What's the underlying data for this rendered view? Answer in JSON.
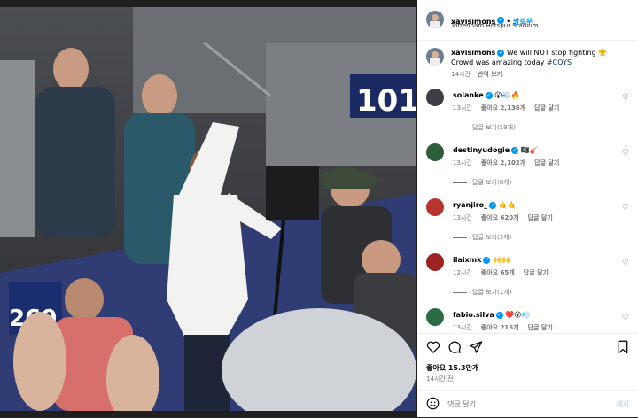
{
  "post": {
    "author": "xavisimons",
    "follow_label": "팔로우",
    "location": "Tottenham Hotspur Stadium",
    "caption_text": "We will NOT stop fighting 😤 Crowd was amazing today",
    "caption_hashtag": "#COYS",
    "caption_time": "14시간",
    "translate_label": "번역 보기",
    "stand_sign_top": "101",
    "stand_sign_left": "260"
  },
  "comments": [
    {
      "user": "solanke",
      "text": "😮💨🔥",
      "time": "13시간",
      "likes": "좋아요 2,136개",
      "reply_label": "답글 달기",
      "view_replies": "답글 보기(19개)",
      "avatar_color": "#3d3d46"
    },
    {
      "user": "destinyudogie",
      "text": "🏴‍☠️🎸",
      "time": "13시간",
      "likes": "좋아요 2,102개",
      "reply_label": "답글 달기",
      "view_replies": "답글 보기(8개)",
      "avatar_color": "#2e5d3a"
    },
    {
      "user": "ryanjiro_",
      "text": "🤙🤙",
      "time": "13시간",
      "likes": "좋아요 620개",
      "reply_label": "답글 달기",
      "view_replies": "답글 보기(5개)",
      "avatar_color": "#b8342e"
    },
    {
      "user": "ilaixmk",
      "text": "🙌🙌",
      "time": "12시간",
      "likes": "좋아요 65개",
      "reply_label": "답글 달기",
      "view_replies": "답글 보기(1개)",
      "avatar_color": "#9c2323"
    },
    {
      "user": "fabio.silva",
      "text": "❤️😮💨",
      "time": "13시간",
      "likes": "좋아요 216개",
      "reply_label": "답글 달기",
      "view_replies": "",
      "avatar_color": "#2d6b45"
    }
  ],
  "actions": {
    "likes_label": "좋아요 15.3만개",
    "time_label": "14시간 전"
  },
  "composer": {
    "placeholder": "댓글 달기...",
    "post_label": "게시"
  },
  "colors": {
    "accent": "#0095f6",
    "hashtag": "#00376b",
    "muted": "#737373"
  },
  "icons": [
    "heart-icon",
    "comment-icon",
    "share-icon",
    "bookmark-icon",
    "emoji-icon",
    "verified-badge-icon"
  ]
}
